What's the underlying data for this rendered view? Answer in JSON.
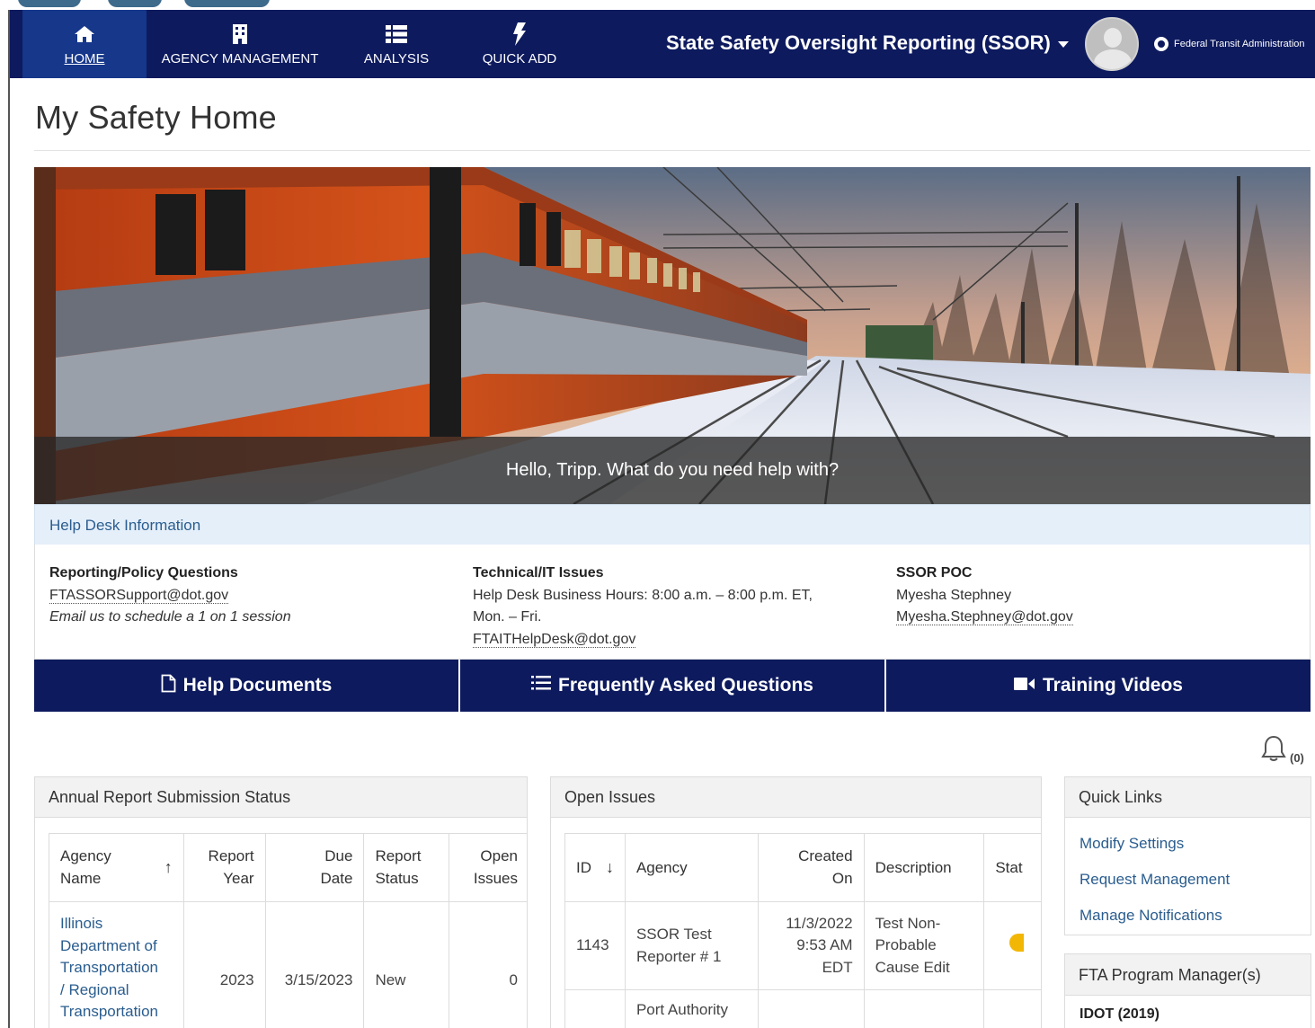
{
  "nav": {
    "items": [
      {
        "label": "HOME",
        "icon": "home-icon",
        "active": true
      },
      {
        "label": "AGENCY MANAGEMENT",
        "icon": "building-icon"
      },
      {
        "label": "ANALYSIS",
        "icon": "list-icon"
      },
      {
        "label": "QUICK ADD",
        "icon": "bolt-icon"
      }
    ],
    "app_title": "State Safety Oversight Reporting (SSOR)",
    "org_name": "Federal Transit Administration",
    "bg_color": "#0d1a5e"
  },
  "page": {
    "title": "My Safety Home"
  },
  "hero": {
    "greeting": "Hello, Tripp. What do you need help with?"
  },
  "helpdesk": {
    "title": "Help Desk Information",
    "reporting": {
      "heading": "Reporting/Policy Questions",
      "email": "FTASSORSupport@dot.gov",
      "note": "Email us to schedule a 1 on 1 session"
    },
    "technical": {
      "heading": "Technical/IT Issues",
      "hours_line1": "Help Desk Business Hours:  8:00 a.m. – 8:00 p.m. ET,",
      "hours_line2": "Mon. – Fri.",
      "email": "FTAITHelpDesk@dot.gov"
    },
    "poc": {
      "heading": "SSOR POC",
      "name": "Myesha Stephney",
      "email": "Myesha.Stephney@dot.gov"
    }
  },
  "buttons": {
    "help_documents": "Help Documents",
    "faq": "Frequently Asked Questions",
    "training_videos": "Training Videos"
  },
  "notifications": {
    "count": "(0)"
  },
  "annual_report": {
    "title": "Annual Report Submission Status",
    "columns": [
      "Agency Name",
      "Report Year",
      "Due Date",
      "Report Status",
      "Open Issues"
    ],
    "rows": [
      {
        "agency": "Illinois Department of Transportation / Regional Transportation",
        "agency_lines": [
          "Illinois",
          "Department of",
          "Transportation",
          "/ Regional",
          "Transportation"
        ],
        "year": "2023",
        "due": "3/15/2023",
        "status": "New",
        "open": "0"
      }
    ]
  },
  "open_issues": {
    "title": "Open Issues",
    "columns": [
      "ID",
      "Agency",
      "Created On",
      "Description",
      "Stat"
    ],
    "rows": [
      {
        "id": "1143",
        "agency": "SSOR Test Reporter # 1",
        "created_line1": "11/3/2022",
        "created_line2": "9:53 AM",
        "created_line3": "EDT",
        "desc_line1": "Test Non-",
        "desc_line2": "Probable",
        "desc_line3": "Cause Edit",
        "status_color": "#f2b705"
      },
      {
        "id": "",
        "agency": "Port Authority"
      }
    ]
  },
  "quick_links": {
    "title": "Quick Links",
    "items": [
      "Modify Settings",
      "Request Management",
      "Manage Notifications"
    ]
  },
  "program_manager": {
    "title": "FTA Program Manager(s)",
    "entry": "IDOT (2019)"
  }
}
